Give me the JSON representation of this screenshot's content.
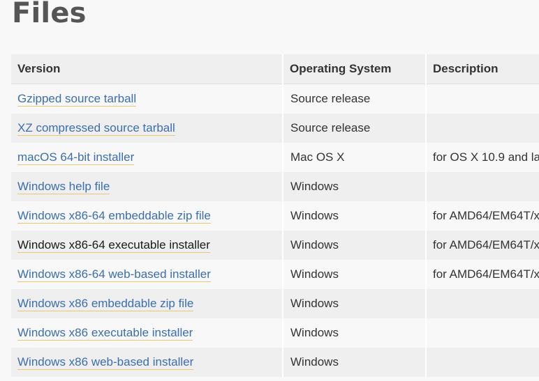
{
  "page": {
    "title": "Files"
  },
  "table": {
    "headers": {
      "version": "Version",
      "os": "Operating System",
      "description": "Description"
    },
    "rows": [
      {
        "version": "Gzipped source tarball",
        "os": "Source release",
        "description": ""
      },
      {
        "version": "XZ compressed source tarball",
        "os": "Source release",
        "description": ""
      },
      {
        "version": "macOS 64-bit installer",
        "os": "Mac OS X",
        "description": "for OS X 10.9 and la"
      },
      {
        "version": "Windows help file",
        "os": "Windows",
        "description": ""
      },
      {
        "version": "Windows x86-64 embeddable zip file",
        "os": "Windows",
        "description": "for AMD64/EM64T/x"
      },
      {
        "version": "Windows x86-64 executable installer",
        "os": "Windows",
        "description": "for AMD64/EM64T/x"
      },
      {
        "version": "Windows x86-64 web-based installer",
        "os": "Windows",
        "description": "for AMD64/EM64T/x"
      },
      {
        "version": "Windows x86 embeddable zip file",
        "os": "Windows",
        "description": ""
      },
      {
        "version": "Windows x86 executable installer",
        "os": "Windows",
        "description": ""
      },
      {
        "version": "Windows x86 web-based installer",
        "os": "Windows",
        "description": ""
      }
    ]
  },
  "colors": {
    "link": "#3b6eb0",
    "link_hover": "#1a1a1a",
    "link_underline": "#e8c773",
    "heading": "#555555",
    "row_stripe": "#efefef"
  }
}
